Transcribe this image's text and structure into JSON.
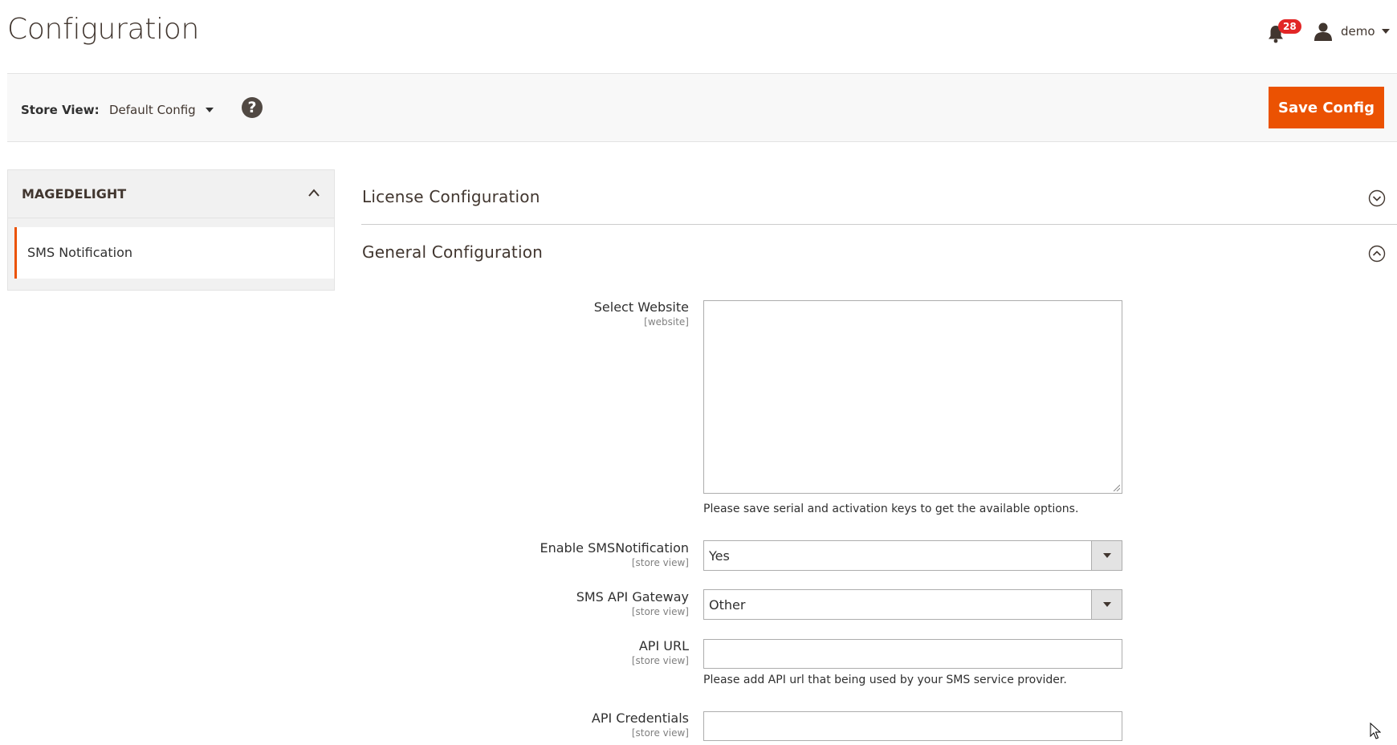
{
  "header": {
    "title": "Configuration",
    "notifications_count": "28",
    "user_name": "demo"
  },
  "toolbar": {
    "store_view_label": "Store View:",
    "store_view_value": "Default Config",
    "help_glyph": "?",
    "save_label": "Save Config"
  },
  "sidebar": {
    "group_title": "MAGEDELIGHT",
    "items": [
      {
        "label": "SMS Notification",
        "active": true
      }
    ]
  },
  "sections": {
    "license": {
      "title": "License Configuration",
      "expanded": false
    },
    "general": {
      "title": "General Configuration",
      "expanded": true
    }
  },
  "fields": {
    "select_website": {
      "label": "Select Website",
      "scope": "[website]",
      "note": "Please save serial and activation keys to get the available options."
    },
    "enable_sms": {
      "label": "Enable SMSNotification",
      "scope": "[store view]",
      "value": "Yes"
    },
    "api_gateway": {
      "label": "SMS API Gateway",
      "scope": "[store view]",
      "value": "Other"
    },
    "api_url": {
      "label": "API URL",
      "scope": "[store view]",
      "value": "",
      "note": "Please add API url that being used by your SMS service provider."
    },
    "api_credentials": {
      "label": "API Credentials",
      "scope": "[store view]",
      "value": ""
    }
  },
  "colors": {
    "accent": "#eb5202",
    "badge": "#e22626",
    "text": "#303030",
    "toolbar_bg": "#f8f8f8",
    "sidebar_bg": "#f1f1f1"
  },
  "icons": {
    "notifications": "bell-icon",
    "user": "user-icon",
    "help": "help-icon",
    "sidebar_toggle": "chevron-up-icon",
    "section_collapsed": "circle-chevron-down-icon",
    "section_expanded": "circle-chevron-up-icon"
  }
}
